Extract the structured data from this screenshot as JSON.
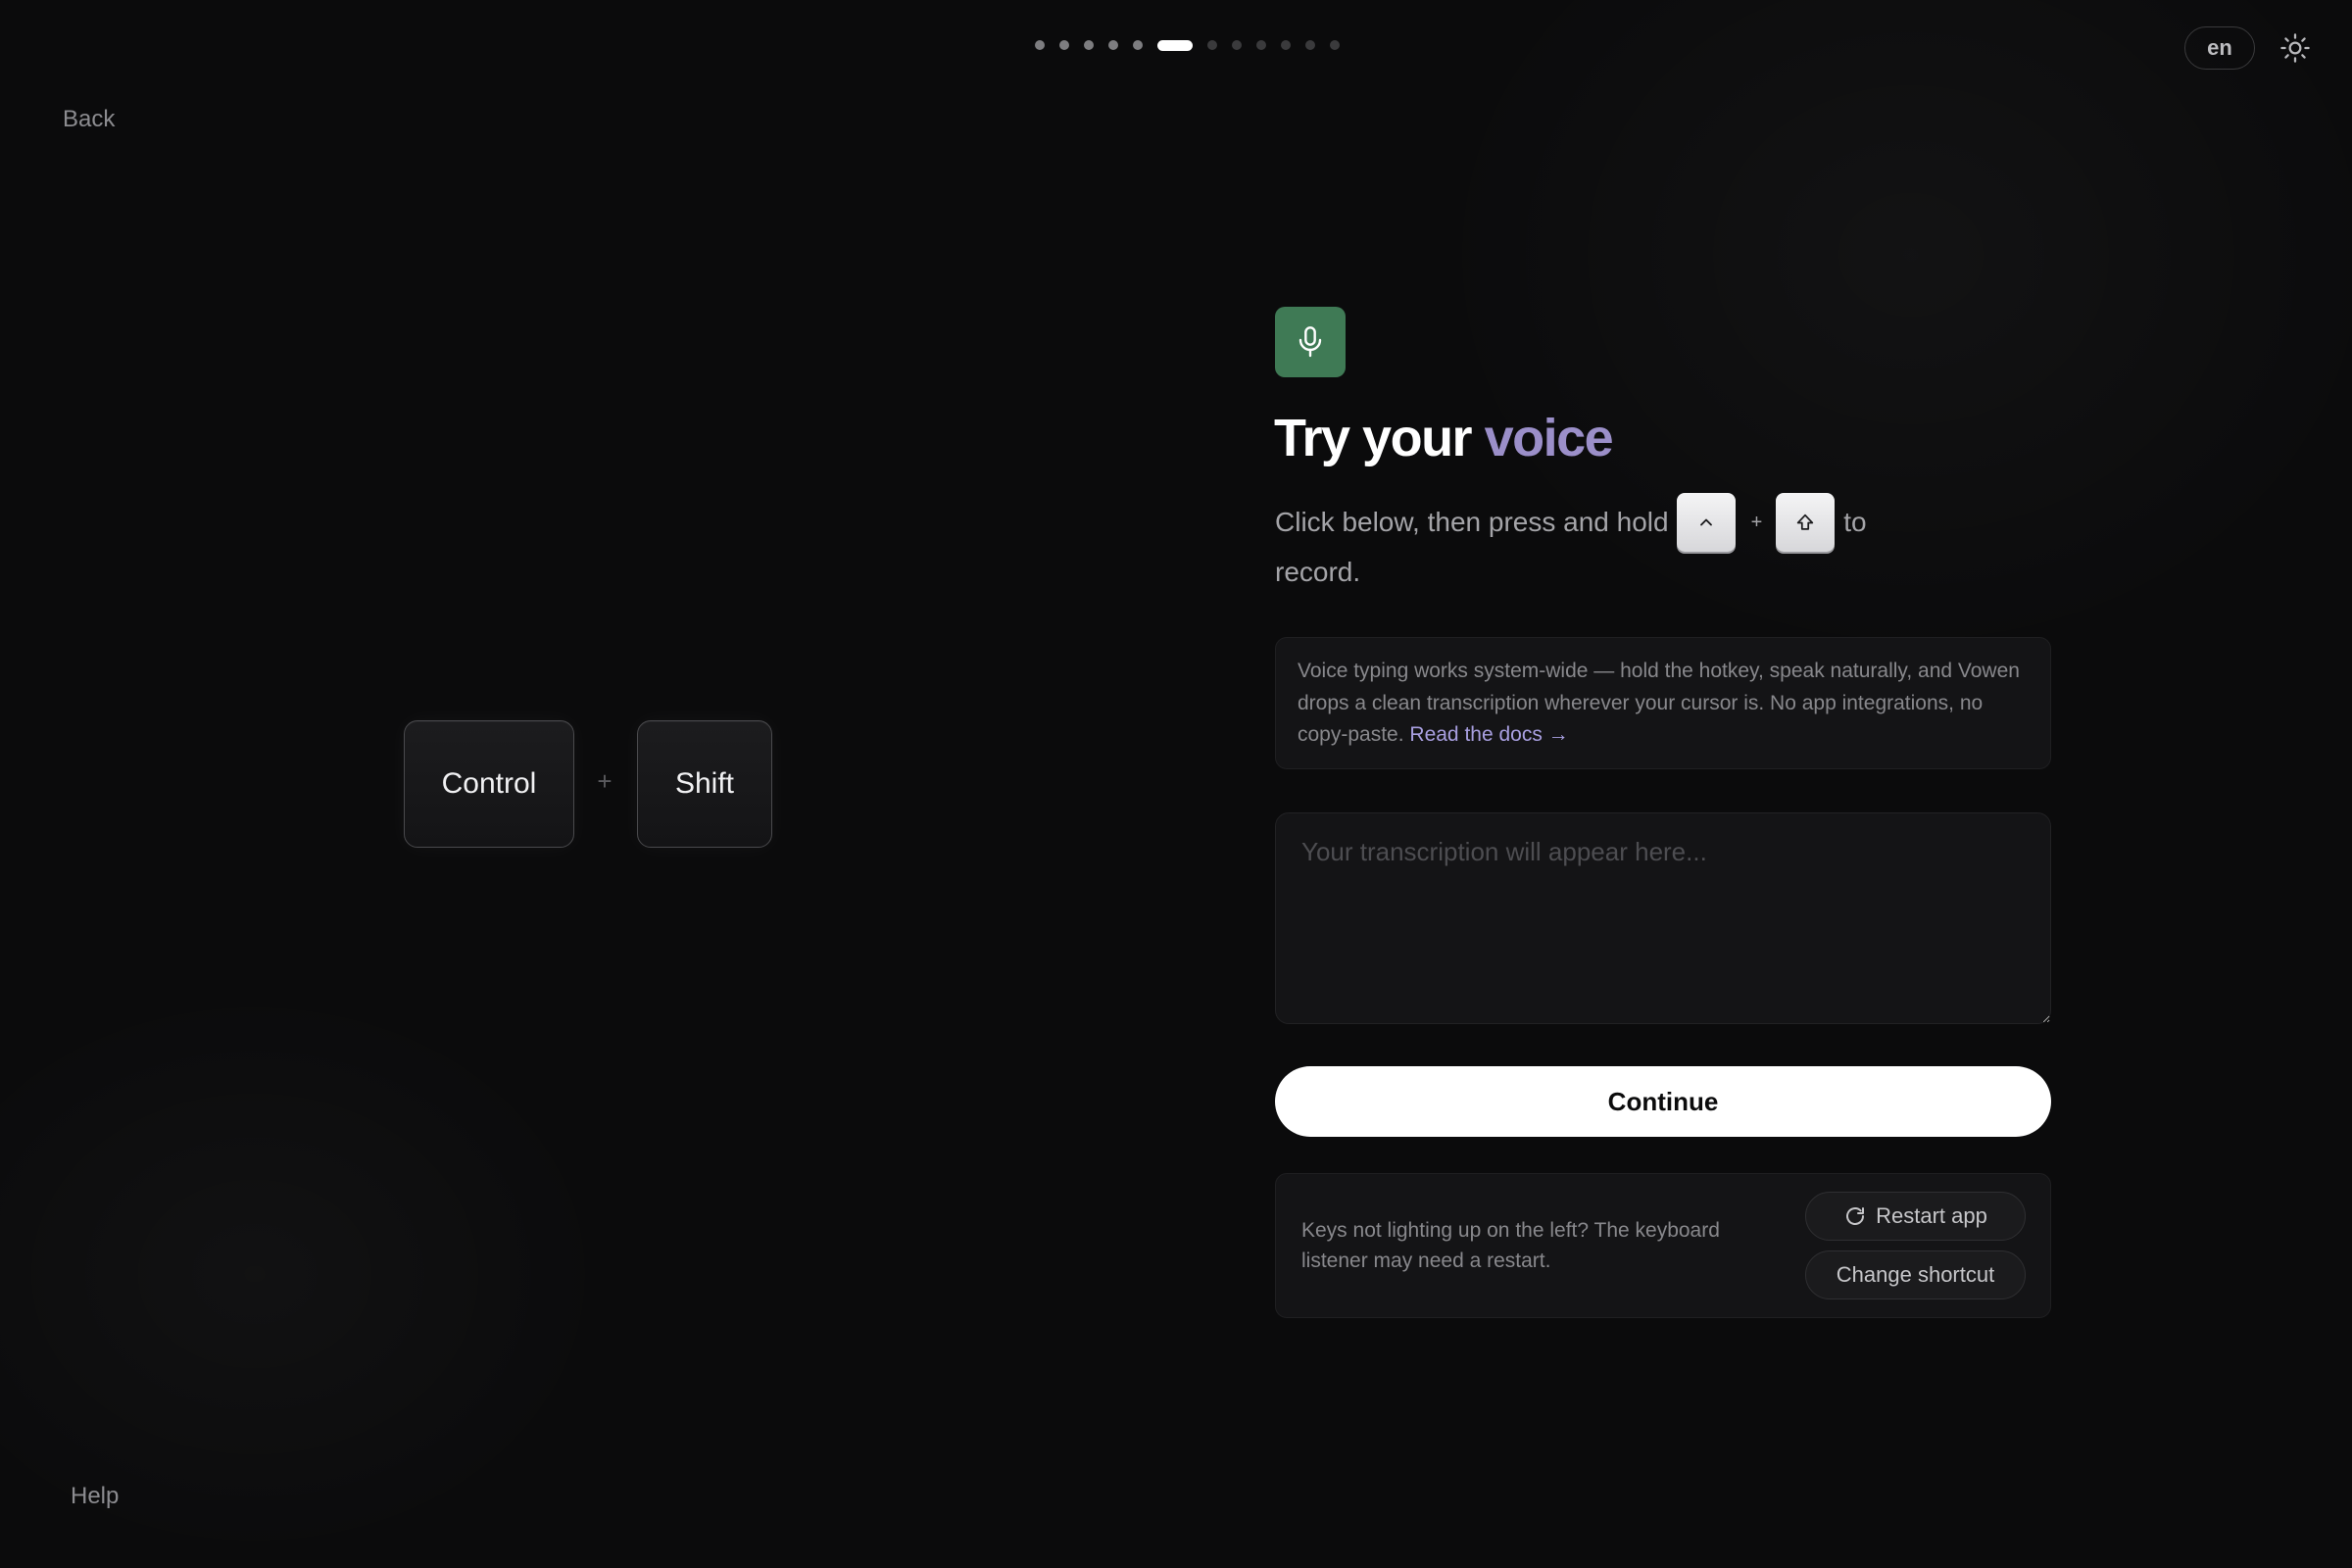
{
  "progress": {
    "total_steps": 12,
    "current_step": 6
  },
  "header": {
    "language": "en",
    "theme_icon": "sun-icon"
  },
  "nav": {
    "back_label": "Back",
    "help_label": "Help"
  },
  "keys_display": {
    "key1": "Control",
    "plus": "+",
    "key2": "Shift"
  },
  "main": {
    "badge_icon": "microphone-icon",
    "badge_color": "#3f7a55",
    "title_prefix": "Try your",
    "title_accent": "voice",
    "accent_color": "#9b8fc9",
    "instruction_before": "Click below, then press and hold",
    "instruction_plus": "+",
    "instruction_to": "to",
    "instruction_after": "record.",
    "key_glyphs": [
      "caret-up-icon",
      "shift-arrow-icon"
    ],
    "info_text": "Voice typing works system-wide — hold the hotkey, speak naturally, and Vowen drops a clean transcription wherever your cursor is. No app integrations, no copy-paste.",
    "info_link": "Read the docs →",
    "transcription_placeholder": "Your transcription will appear here...",
    "continue_label": "Continue"
  },
  "troubleshoot": {
    "text": "Keys not lighting up on the left? The keyboard listener may need a restart.",
    "restart_label": "Restart app",
    "restart_icon": "refresh-icon",
    "change_shortcut_label": "Change shortcut"
  }
}
